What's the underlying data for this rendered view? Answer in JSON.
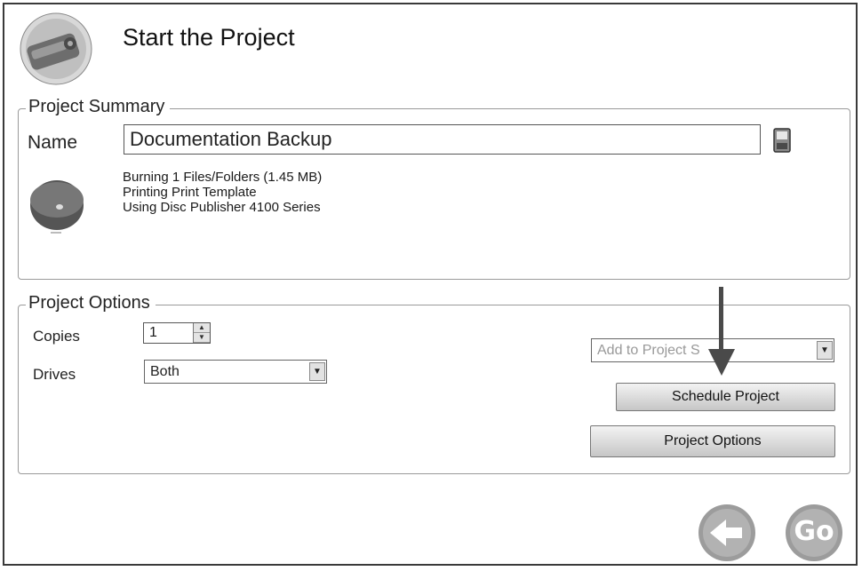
{
  "header": {
    "title": "Start the Project",
    "icon": "disc-publisher-icon"
  },
  "summary": {
    "legend": "Project Summary",
    "name_label": "Name",
    "name_value": "Documentation Backup",
    "lines": [
      "Burning 1 Files/Folders (1.45 MB)",
      "Printing Print Template",
      "Using Disc Publisher 4100 Series"
    ]
  },
  "options": {
    "legend": "Project Options",
    "copies_label": "Copies",
    "copies_value": "1",
    "drives_label": "Drives",
    "drives_value": "Both",
    "project_select_value": "Add to Project S",
    "schedule_label": "Schedule Project",
    "options_label": "Project Options"
  },
  "nav": {
    "go_label": "Go"
  }
}
